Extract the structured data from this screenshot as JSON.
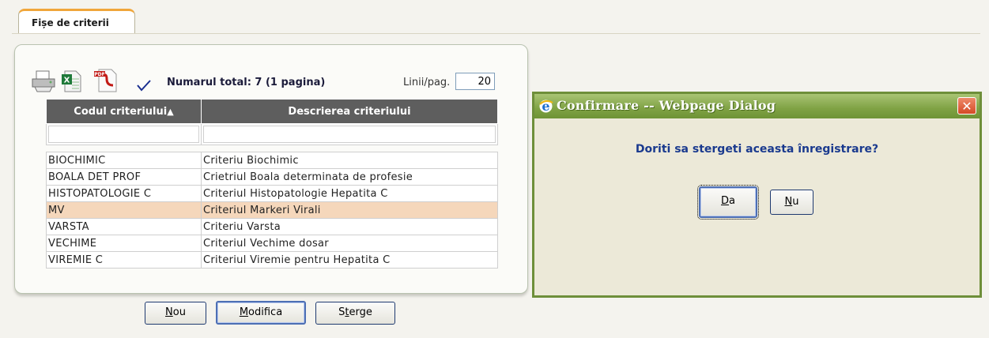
{
  "tab": {
    "label": "Fișe de criterii"
  },
  "toolbar": {
    "total_label": "Numarul total: 7 (1 pagina)",
    "lines_label": "Linii/pag.",
    "lines_value": "20",
    "icons": [
      "printer-icon",
      "excel-icon",
      "pdf-icon",
      "check-icon"
    ]
  },
  "table": {
    "columns": [
      "Codul criteriului",
      "Descrierea criteriului"
    ],
    "sort_indicator": "▲",
    "rows": [
      {
        "code": "BIOCHIMIC",
        "desc": "Criteriu Biochimic"
      },
      {
        "code": "BOALA DET PROF",
        "desc": "Crietriul Boala determinata de profesie"
      },
      {
        "code": "HISTOPATOLOGIE C",
        "desc": "Criteriul Histopatologie Hepatita C"
      },
      {
        "code": "MV",
        "desc": "Criteriul Markeri Virali"
      },
      {
        "code": "VARSTA",
        "desc": "Criteriu Varsta"
      },
      {
        "code": "VECHIME",
        "desc": "Criteriul Vechime dosar"
      },
      {
        "code": "VIREMIE C",
        "desc": "Criteriul Viremie pentru Hepatita C"
      }
    ],
    "selected_row": 3
  },
  "buttons": {
    "new": {
      "prefix": "",
      "key": "N",
      "rest": "ou"
    },
    "edit": {
      "prefix": "",
      "key": "M",
      "rest": "odifica"
    },
    "delete": {
      "prefix": "S",
      "key": "t",
      "rest": "erge"
    }
  },
  "dialog": {
    "title": "Confirmare -- Webpage Dialog",
    "message": "Doriti sa stergeti aceasta înregistrare?",
    "yes": {
      "key": "D",
      "rest": "a"
    },
    "no": {
      "key": "N",
      "rest": "u"
    },
    "close": "✕"
  },
  "colors": {
    "selected_row": "#f5d7bb",
    "header_bg": "#5e5e5e",
    "dialog_title": "#7fa244",
    "message": "#1a3a8e"
  }
}
